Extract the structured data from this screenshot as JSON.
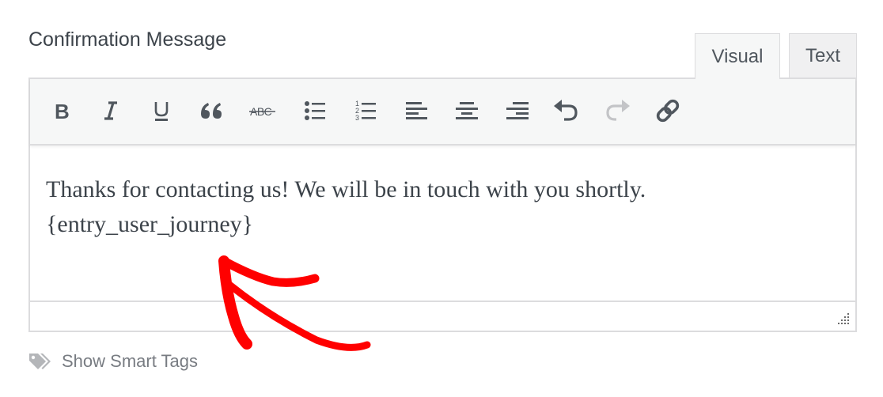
{
  "field": {
    "label": "Confirmation Message"
  },
  "editor_tabs": [
    {
      "label": "Visual",
      "active": true
    },
    {
      "label": "Text",
      "active": false
    }
  ],
  "toolbar": {
    "buttons": [
      {
        "name": "bold",
        "icon": "bold-icon"
      },
      {
        "name": "italic",
        "icon": "italic-icon"
      },
      {
        "name": "underline",
        "icon": "underline-icon"
      },
      {
        "name": "blockquote",
        "icon": "blockquote-icon"
      },
      {
        "name": "strikethrough",
        "icon": "strikethrough-icon",
        "glyph": "ABC"
      },
      {
        "name": "bulleted-list",
        "icon": "bulleted-list-icon"
      },
      {
        "name": "numbered-list",
        "icon": "numbered-list-icon"
      },
      {
        "name": "align-left",
        "icon": "align-left-icon"
      },
      {
        "name": "align-center",
        "icon": "align-center-icon"
      },
      {
        "name": "align-right",
        "icon": "align-right-icon"
      },
      {
        "name": "undo",
        "icon": "undo-icon",
        "enabled": true
      },
      {
        "name": "redo",
        "icon": "redo-icon",
        "enabled": false
      },
      {
        "name": "link",
        "icon": "link-icon"
      }
    ]
  },
  "content": {
    "line1": "Thanks for contacting us! We will be in touch with you shortly.",
    "line2": "{entry_user_journey}"
  },
  "smart_tags": {
    "label": "Show Smart Tags",
    "icon": "tags-icon"
  },
  "colors": {
    "icon": "#50575e",
    "disabled_icon": "#c3c4c7",
    "annotation_arrow": "#ff0000",
    "border": "#dcdcde"
  }
}
